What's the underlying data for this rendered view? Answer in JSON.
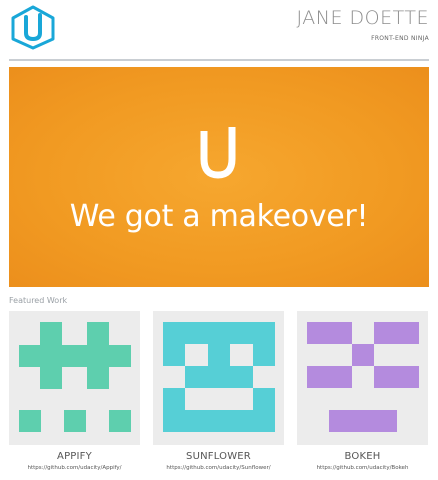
{
  "header": {
    "logo_icon": "udacity-u-logo-icon",
    "name": "JANE DOETTE",
    "role": "FRONT-END NINJA"
  },
  "hero": {
    "mark_icon": "udacity-u-mark-icon",
    "headline": "We got a makeover!",
    "background": "#f29c22"
  },
  "featured": {
    "title": "Featured Work",
    "items": [
      {
        "title": "APPIFY",
        "url": "https://github.com/udacity/Appify/",
        "color": "#5ecfae"
      },
      {
        "title": "SUNFLOWER",
        "url": "https://github.com/udacity/Sunflower/",
        "color": "#56cfd6"
      },
      {
        "title": "BOKEH",
        "url": "https://github.com/udacity/Bokeh",
        "color": "#b48bde"
      }
    ]
  }
}
